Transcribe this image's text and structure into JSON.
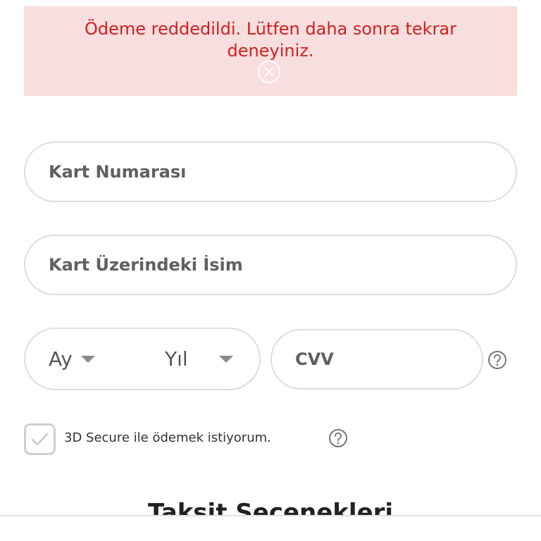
{
  "alert": {
    "message": "Ödeme reddedildi. Lütfen daha sonra tekrar deneyiniz.",
    "close_icon": "close-circle-icon",
    "background": "#f8dede",
    "text_color": "#d21f1f"
  },
  "form": {
    "card_number": {
      "placeholder": "Kart Numarası",
      "value": ""
    },
    "card_name": {
      "placeholder": "Kart Üzerindeki İsim",
      "value": ""
    },
    "month": {
      "label": "Ay"
    },
    "year": {
      "label": "Yıl"
    },
    "cvv": {
      "placeholder": "CVV",
      "value": ""
    },
    "secure3d": {
      "label": "3D Secure ile ödemek istiyorum.",
      "checked": true
    }
  },
  "icons": {
    "help": "question-circle-icon",
    "dropdown": "caret-down-icon",
    "check": "check-icon"
  },
  "section": {
    "title": "Taksit Seçenekleri"
  }
}
